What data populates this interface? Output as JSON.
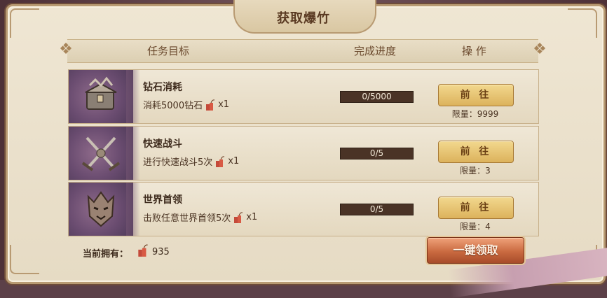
{
  "title": "获取爆竹",
  "header": {
    "col_task": "任务目标",
    "col_progress": "完成进度",
    "col_action": "操 作"
  },
  "tasks": [
    {
      "name": "钻石消耗",
      "desc": "消耗5000钻石",
      "reward_count": "x1",
      "progress": "0/5000",
      "button": "前 往",
      "limit": "限量：9999",
      "icon": "treasure-chest-icon"
    },
    {
      "name": "快速战斗",
      "desc": "进行快速战斗5次",
      "reward_count": "x1",
      "progress": "0/5",
      "button": "前 往",
      "limit": "限量：3",
      "icon": "crossed-swords-icon"
    },
    {
      "name": "世界首领",
      "desc": "击败任意世界首领5次",
      "reward_count": "x1",
      "progress": "0/5",
      "button": "前 往",
      "limit": "限量：4",
      "icon": "boss-helmet-icon"
    }
  ],
  "footer": {
    "owned_label": "当前拥有：",
    "owned_value": "935",
    "claim_all": "一键领取"
  },
  "colors": {
    "panel_bg": "#e6dbc4",
    "progress_bg": "#4a3326",
    "go_button": "#dcb25c",
    "claim_button": "#c96a40"
  }
}
